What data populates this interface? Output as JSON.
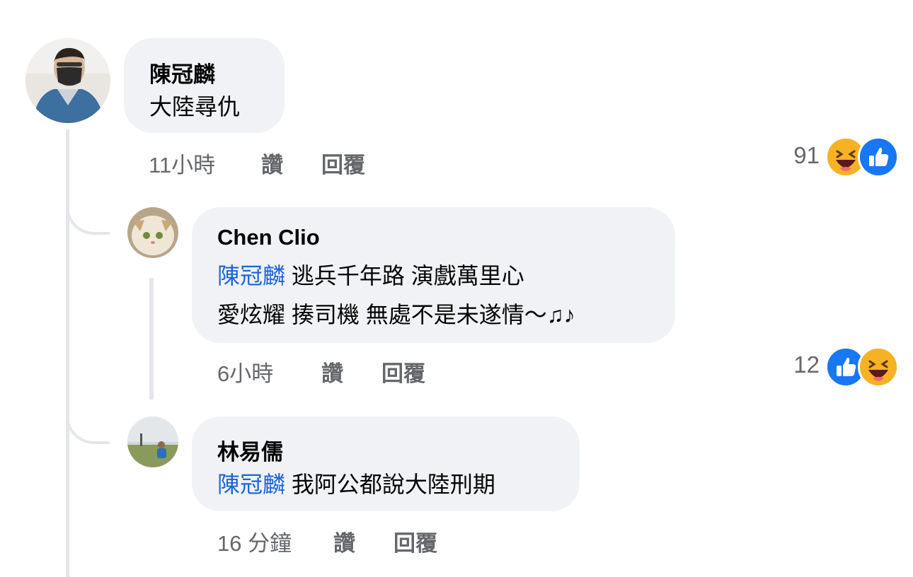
{
  "comments": [
    {
      "author": "陳冠麟",
      "text": "大陸尋仇",
      "time": "11小時",
      "like_label": "讚",
      "reply_label": "回覆",
      "reaction_count": "91",
      "reactions": [
        "haha-icon",
        "like-icon"
      ]
    }
  ],
  "replies": [
    {
      "author": "Chen Clio",
      "mention": "陳冠麟",
      "line1": "逃兵千年路 演戲萬里心",
      "line2": "愛炫耀 揍司機 無處不是未遂情～♫♪",
      "time": "6小時",
      "like_label": "讚",
      "reply_label": "回覆",
      "reaction_count": "12",
      "reactions": [
        "like-icon",
        "haha-icon"
      ]
    },
    {
      "author": "林易儒",
      "mention": "陳冠麟",
      "text": "我阿公都說大陸刑期",
      "time": "16 分鐘",
      "like_label": "讚",
      "reply_label": "回覆"
    }
  ],
  "colors": {
    "bubble": "#f0f2f5",
    "mention": "#1b64d8",
    "meta": "#65676b",
    "like_blue": "#1877f2",
    "haha_yellow": "#f7b125"
  }
}
